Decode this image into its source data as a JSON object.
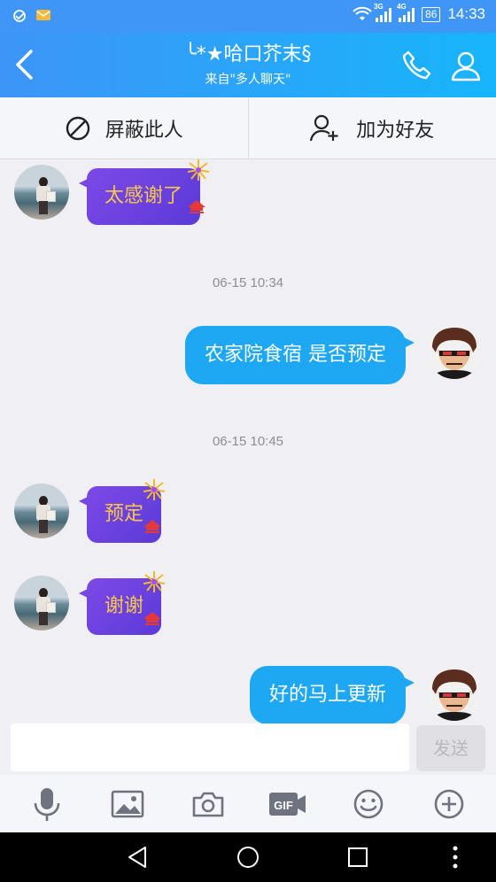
{
  "status_bar": {
    "time": "14:33",
    "battery": "86",
    "net_3g": "3G",
    "net_4g": "4G"
  },
  "header": {
    "title": "╰*★哈口芥末§",
    "subtitle": "来自\"多人聊天\""
  },
  "actions": {
    "block_label": "屏蔽此人",
    "add_friend_label": "加为好友"
  },
  "messages": [
    {
      "side": "left",
      "text": "太感谢了"
    },
    {
      "type": "time",
      "text": "06-15 10:34"
    },
    {
      "side": "right",
      "text": "农家院食宿 是否预定"
    },
    {
      "type": "time",
      "text": "06-15 10:45"
    },
    {
      "side": "left",
      "text": "预定"
    },
    {
      "side": "left",
      "text": "谢谢"
    },
    {
      "side": "right",
      "text": "好的马上更新"
    }
  ],
  "input": {
    "placeholder": "",
    "value": "",
    "send_label": "发送"
  },
  "colors": {
    "header_start": "#3d95f7",
    "header_end": "#17b5fb",
    "bubble_left": "#6d43e2",
    "bubble_left_text": "#f7c74b",
    "bubble_right": "#1ea8f4"
  }
}
